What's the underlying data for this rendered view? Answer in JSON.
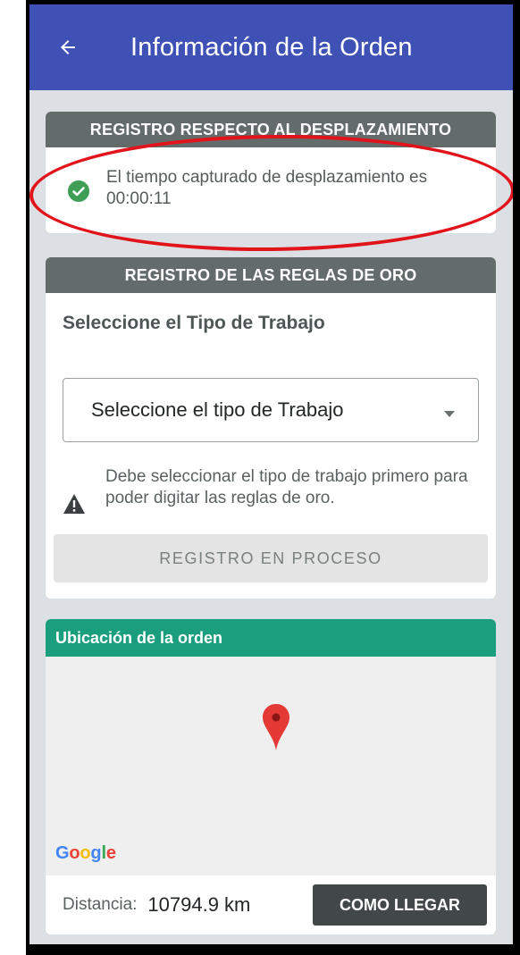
{
  "appbar": {
    "title": "Información de la Orden",
    "back_icon": "arrow-left-icon",
    "color": "#3f51b5"
  },
  "displacement": {
    "header": "REGISTRO RESPECTO AL DESPLAZAMIENTO",
    "status_icon": "check-circle-icon",
    "message": "El tiempo capturado de desplazamiento es 00:00:11"
  },
  "golden_rules": {
    "header": "REGISTRO DE LAS REGLAS DE ORO",
    "section_label": "Seleccione el Tipo de Trabajo",
    "dropdown_value": "Seleccione el tipo de Trabajo",
    "warning_icon": "warning-icon",
    "warning_text": "Debe seleccionar el tipo de trabajo primero para poder digitar las reglas de oro.",
    "process_button": "REGISTRO EN PROCESO"
  },
  "location": {
    "header": "Ubicación de la orden",
    "map_logo": "Google",
    "distance_label": "Distancia:",
    "distance_value": "10794.9 km",
    "directions_button": "COMO LLEGAR",
    "header_color": "#1a9e7e"
  },
  "annotation_color": "#e2141b"
}
